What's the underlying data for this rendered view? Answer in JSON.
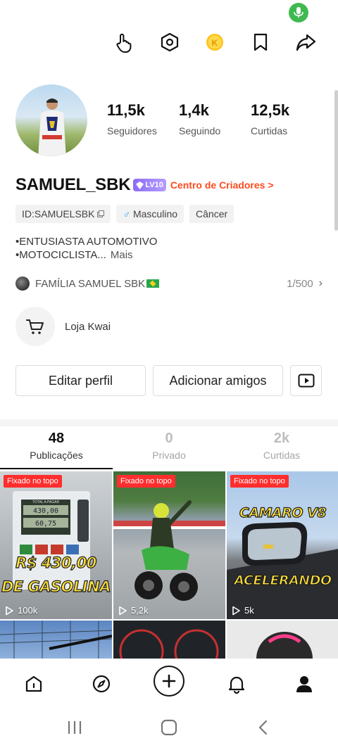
{
  "status": {
    "mic_icon": "mic-icon"
  },
  "header": {
    "icons": [
      "hand-pointer-icon",
      "hexagon-settings-icon",
      "coin-icon",
      "bookmark-icon",
      "share-icon"
    ],
    "coin_letter": "K"
  },
  "profile": {
    "stats": [
      {
        "value": "11,5k",
        "label": "Seguidores"
      },
      {
        "value": "1,4k",
        "label": "Seguindo"
      },
      {
        "value": "12,5k",
        "label": "Curtidas"
      }
    ],
    "username": "SAMUEL_SBK",
    "level": "LV10",
    "creator_link": "Centro de Criadores >",
    "tags": [
      {
        "text": "ID:SAMUELSBK",
        "icon": "copy-icon"
      },
      {
        "text": "Masculino",
        "icon": "male-icon",
        "icon_glyph": "♂"
      },
      {
        "text": "Câncer"
      }
    ],
    "bio_line1": "•ENTUSIASTA AUTOMOTIVO",
    "bio_line2": "•MOTOCICLISTA...",
    "bio_more": "Mais",
    "family": {
      "name": "FAMÍLIA SAMUEL SBK",
      "count": "1/500",
      "chevron": "›"
    },
    "shop_label": "Loja Kwai"
  },
  "actions": {
    "edit_label": "Editar perfil",
    "add_label": "Adicionar amigos"
  },
  "tabs": [
    {
      "count": "48",
      "label": "Publicações",
      "active": true
    },
    {
      "count": "0",
      "label": "Privado",
      "active": false
    },
    {
      "count": "2k",
      "label": "Curtidas",
      "active": false
    }
  ],
  "grid": [
    {
      "pin": "Fixado no topo",
      "views": "100k",
      "text1": "R$ 430,00",
      "text2": "DE GASOLINA",
      "pump_total": "TOTAL A PAGAR",
      "pump_value": "430,00",
      "pump_liters": "60,75"
    },
    {
      "pin": "Fixado no topo",
      "views": "5,2k"
    },
    {
      "pin": "Fixado no topo",
      "views": "5k",
      "text1": "CAMARO V8",
      "text2": "ACELERANDO"
    }
  ],
  "bottom_nav": [
    "home-icon",
    "explore-icon",
    "plus-icon",
    "bell-icon",
    "profile-icon"
  ],
  "colors": {
    "accent": "#ff4b1f",
    "pin": "#ff2e2e",
    "level": "#8c6cf5",
    "overlay_text": "#ffe23b"
  }
}
